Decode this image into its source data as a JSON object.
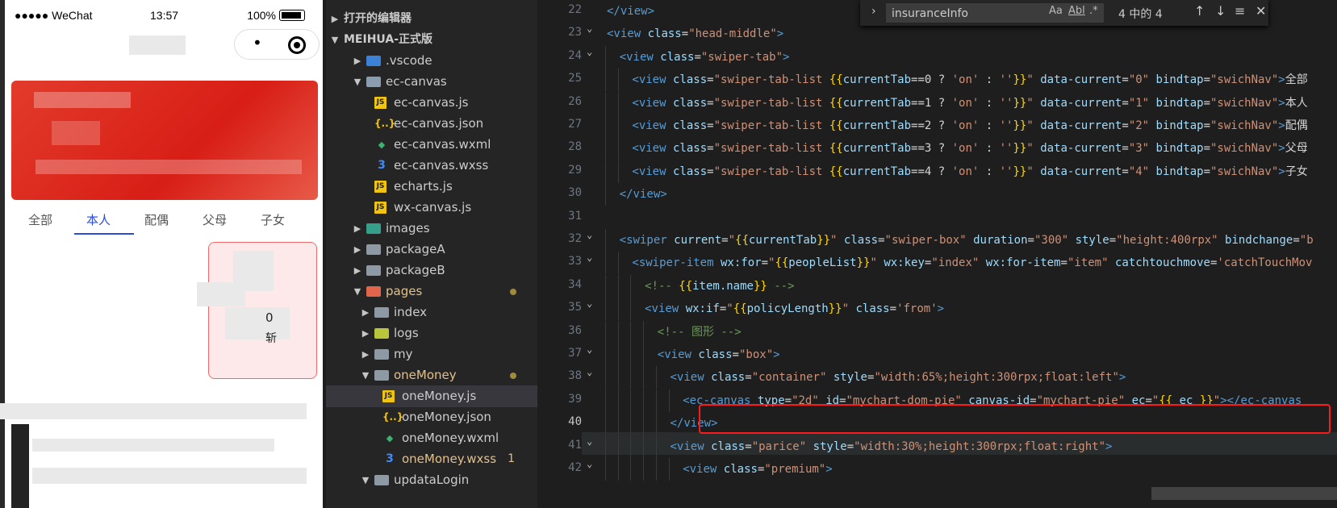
{
  "phone": {
    "carrier": "●●●●● WeChat",
    "time": "13:57",
    "battery": "100%",
    "tabs": [
      "全部",
      "本人",
      "配偶",
      "父母",
      "子女"
    ],
    "active_tab": 1,
    "visible_digit": "0",
    "visible_char": "斩"
  },
  "explorer": {
    "open_editors": "打开的编辑器",
    "project": "MEIHUA-正式版",
    "items": [
      {
        "label": ".vscode",
        "type": "folder-vscode",
        "depth": 1,
        "arrow": "▶"
      },
      {
        "label": "ec-canvas",
        "type": "folder-ec",
        "depth": 1,
        "arrow": "▼"
      },
      {
        "label": "ec-canvas.js",
        "type": "js",
        "depth": 2
      },
      {
        "label": "ec-canvas.json",
        "type": "json",
        "depth": 2
      },
      {
        "label": "ec-canvas.wxml",
        "type": "wxml",
        "depth": 2
      },
      {
        "label": "ec-canvas.wxss",
        "type": "wxss",
        "depth": 2
      },
      {
        "label": "echarts.js",
        "type": "js",
        "depth": 2
      },
      {
        "label": "wx-canvas.js",
        "type": "js",
        "depth": 2
      },
      {
        "label": "images",
        "type": "folder-images",
        "depth": 1,
        "arrow": "▶"
      },
      {
        "label": "packageA",
        "type": "folder",
        "depth": 1,
        "arrow": "▶"
      },
      {
        "label": "packageB",
        "type": "folder",
        "depth": 1,
        "arrow": "▶"
      },
      {
        "label": "pages",
        "type": "folder-pages",
        "depth": 1,
        "arrow": "▼",
        "modified": true
      },
      {
        "label": "index",
        "type": "folder",
        "depth": 2,
        "arrow": "▶"
      },
      {
        "label": "logs",
        "type": "folder-logs",
        "depth": 2,
        "arrow": "▶"
      },
      {
        "label": "my",
        "type": "folder",
        "depth": 2,
        "arrow": "▶"
      },
      {
        "label": "oneMoney",
        "type": "folder",
        "depth": 2,
        "arrow": "▼",
        "modified": true
      },
      {
        "label": "oneMoney.js",
        "type": "js",
        "depth": 3,
        "selected": true
      },
      {
        "label": "oneMoney.json",
        "type": "json",
        "depth": 3
      },
      {
        "label": "oneMoney.wxml",
        "type": "wxml",
        "depth": 3
      },
      {
        "label": "oneMoney.wxss",
        "type": "wxss",
        "depth": 3,
        "modified": true,
        "badge": "1"
      },
      {
        "label": "updataLogin",
        "type": "folder",
        "depth": 2,
        "arrow": "▼"
      }
    ]
  },
  "find": {
    "query": "insuranceInfo",
    "match_case": "Aa",
    "whole_word": "Abl",
    "regex": ".*",
    "count": "4 中的 4",
    "prev": "↑",
    "next": "↓",
    "menu": "≡",
    "close": "✕"
  },
  "editor": {
    "current_line": 40,
    "lines": [
      {
        "n": 22,
        "indent": 0,
        "fold": "",
        "html": "<span class='t'>&lt;/view&gt;</span>"
      },
      {
        "n": 23,
        "indent": 0,
        "fold": "⌄",
        "html": "<span class='t'>&lt;view</span> <span class='a'>class</span><span class='p'>=</span><span class='s'>\"head-middle\"</span><span class='t'>&gt;</span>"
      },
      {
        "n": 24,
        "indent": 1,
        "fold": "⌄",
        "html": "<span class='t'>&lt;view</span> <span class='a'>class</span><span class='p'>=</span><span class='s'>\"swiper-tab\"</span><span class='t'>&gt;</span>"
      },
      {
        "n": 25,
        "indent": 2,
        "fold": "",
        "html": "<span class='t'>&lt;view</span> <span class='a'>class</span><span class='p'>=</span><span class='s'>\"swiper-tab-list </span><span class='m'>{{</span><span class='a'>currentTab</span><span class='p'>==0 ? </span><span class='s'>'on'</span><span class='p'> : </span><span class='s'>''</span><span class='m'>}}</span><span class='s'>\"</span> <span class='a'>data-current</span><span class='p'>=</span><span class='s'>\"0\"</span> <span class='a'>bindtap</span><span class='p'>=</span><span class='s'>\"swichNav\"</span><span class='t'>&gt;</span><span class='p'>全部</span>"
      },
      {
        "n": 26,
        "indent": 2,
        "fold": "",
        "html": "<span class='t'>&lt;view</span> <span class='a'>class</span><span class='p'>=</span><span class='s'>\"swiper-tab-list </span><span class='m'>{{</span><span class='a'>currentTab</span><span class='p'>==1 ? </span><span class='s'>'on'</span><span class='p'> : </span><span class='s'>''</span><span class='m'>}}</span><span class='s'>\"</span> <span class='a'>data-current</span><span class='p'>=</span><span class='s'>\"1\"</span> <span class='a'>bindtap</span><span class='p'>=</span><span class='s'>\"swichNav\"</span><span class='t'>&gt;</span><span class='p'>本人</span>"
      },
      {
        "n": 27,
        "indent": 2,
        "fold": "",
        "html": "<span class='t'>&lt;view</span> <span class='a'>class</span><span class='p'>=</span><span class='s'>\"swiper-tab-list </span><span class='m'>{{</span><span class='a'>currentTab</span><span class='p'>==2 ? </span><span class='s'>'on'</span><span class='p'> : </span><span class='s'>''</span><span class='m'>}}</span><span class='s'>\"</span> <span class='a'>data-current</span><span class='p'>=</span><span class='s'>\"2\"</span> <span class='a'>bindtap</span><span class='p'>=</span><span class='s'>\"swichNav\"</span><span class='t'>&gt;</span><span class='p'>配偶</span>"
      },
      {
        "n": 28,
        "indent": 2,
        "fold": "",
        "html": "<span class='t'>&lt;view</span> <span class='a'>class</span><span class='p'>=</span><span class='s'>\"swiper-tab-list </span><span class='m'>{{</span><span class='a'>currentTab</span><span class='p'>==3 ? </span><span class='s'>'on'</span><span class='p'> : </span><span class='s'>''</span><span class='m'>}}</span><span class='s'>\"</span> <span class='a'>data-current</span><span class='p'>=</span><span class='s'>\"3\"</span> <span class='a'>bindtap</span><span class='p'>=</span><span class='s'>\"swichNav\"</span><span class='t'>&gt;</span><span class='p'>父母</span>"
      },
      {
        "n": 29,
        "indent": 2,
        "fold": "",
        "html": "<span class='t'>&lt;view</span> <span class='a'>class</span><span class='p'>=</span><span class='s'>\"swiper-tab-list </span><span class='m'>{{</span><span class='a'>currentTab</span><span class='p'>==4 ? </span><span class='s'>'on'</span><span class='p'> : </span><span class='s'>''</span><span class='m'>}}</span><span class='s'>\"</span> <span class='a'>data-current</span><span class='p'>=</span><span class='s'>\"4\"</span> <span class='a'>bindtap</span><span class='p'>=</span><span class='s'>\"swichNav\"</span><span class='t'>&gt;</span><span class='p'>子女</span>"
      },
      {
        "n": 30,
        "indent": 1,
        "fold": "",
        "html": "<span class='t'>&lt;/view&gt;</span>"
      },
      {
        "n": 31,
        "indent": 0,
        "fold": "",
        "html": ""
      },
      {
        "n": 32,
        "indent": 1,
        "fold": "⌄",
        "html": "<span class='t'>&lt;swiper</span> <span class='a'>current</span><span class='p'>=</span><span class='s'>\"</span><span class='m'>{{</span><span class='a'>currentTab</span><span class='m'>}}</span><span class='s'>\"</span> <span class='a'>class</span><span class='p'>=</span><span class='s'>\"swiper-box\"</span> <span class='a'>duration</span><span class='p'>=</span><span class='s'>\"300\"</span> <span class='a'>style</span><span class='p'>=</span><span class='s'>\"height:400rpx\"</span> <span class='a'>bindchange</span><span class='p'>=</span><span class='s'>\"b</span>"
      },
      {
        "n": 33,
        "indent": 2,
        "fold": "⌄",
        "html": "<span class='t'>&lt;swiper-item</span> <span class='a'>wx:for</span><span class='p'>=</span><span class='s'>\"</span><span class='m'>{{</span><span class='a'>peopleList</span><span class='m'>}}</span><span class='s'>\"</span> <span class='a'>wx:key</span><span class='p'>=</span><span class='s'>\"index\"</span> <span class='a'>wx:for-item</span><span class='p'>=</span><span class='s'>\"item\"</span> <span class='a'>catchtouchmove</span><span class='p'>=</span><span class='s'>'catchTouchMov</span>"
      },
      {
        "n": 34,
        "indent": 3,
        "fold": "",
        "html": "<span class='c'>&lt;!-- </span><span class='m'>{{</span><span class='a'>item.name</span><span class='m'>}}</span><span class='c'> --&gt;</span>"
      },
      {
        "n": 35,
        "indent": 3,
        "fold": "⌄",
        "html": "<span class='t'>&lt;view</span> <span class='a'>wx:if</span><span class='p'>=</span><span class='s'>\"</span><span class='m'>{{</span><span class='a'>policyLength</span><span class='m'>}}</span><span class='s'>\"</span> <span class='a'>class</span><span class='p'>=</span><span class='s'>'from'</span><span class='t'>&gt;</span>"
      },
      {
        "n": 36,
        "indent": 4,
        "fold": "",
        "html": "<span class='c'>&lt;!-- 图形 --&gt;</span>"
      },
      {
        "n": 37,
        "indent": 4,
        "fold": "⌄",
        "html": "<span class='t'>&lt;view</span> <span class='a'>class</span><span class='p'>=</span><span class='s'>\"box\"</span><span class='t'>&gt;</span>"
      },
      {
        "n": 38,
        "indent": 5,
        "fold": "⌄",
        "html": "<span class='t'>&lt;view</span> <span class='a'>class</span><span class='p'>=</span><span class='s'>\"container\"</span> <span class='a'>style</span><span class='p'>=</span><span class='s'>\"width:65%;height:300rpx;float:left\"</span><span class='t'>&gt;</span>"
      },
      {
        "n": 39,
        "indent": 6,
        "fold": "",
        "html": "<span class='t'>&lt;ec-canvas</span> <span class='a'>type</span><span class='p'>=</span><span class='s'>\"2d\"</span> <span class='a'>id</span><span class='p'>=</span><span class='s'>\"mychart-dom-pie\"</span> <span class='a'>canvas-id</span><span class='p'>=</span><span class='s'>\"mychart-pie\"</span> <span class='a'>ec</span><span class='p'>=</span><span class='s'>\"</span><span class='m'>{{</span><span class='a'> ec </span><span class='m'>}}</span><span class='s'>\"</span><span class='t'>&gt;&lt;/ec-canvas</span>"
      },
      {
        "n": 40,
        "indent": 5,
        "fold": "",
        "html": "<span class='t'>&lt;/view&gt;</span>"
      },
      {
        "n": 41,
        "indent": 5,
        "fold": "⌄",
        "html": "<span class='t'>&lt;view</span> <span class='a'>class</span><span class='p'>=</span><span class='s'>\"parice\"</span> <span class='a'>style</span><span class='p'>=</span><span class='s'>\"width:30%;height:300rpx;float:right\"</span><span class='t'>&gt;</span>"
      },
      {
        "n": 42,
        "indent": 6,
        "fold": "⌄",
        "html": "<span class='t'>&lt;view</span> <span class='a'>class</span><span class='p'>=</span><span class='s'>\"premium\"</span><span class='t'>&gt;</span>"
      }
    ]
  }
}
